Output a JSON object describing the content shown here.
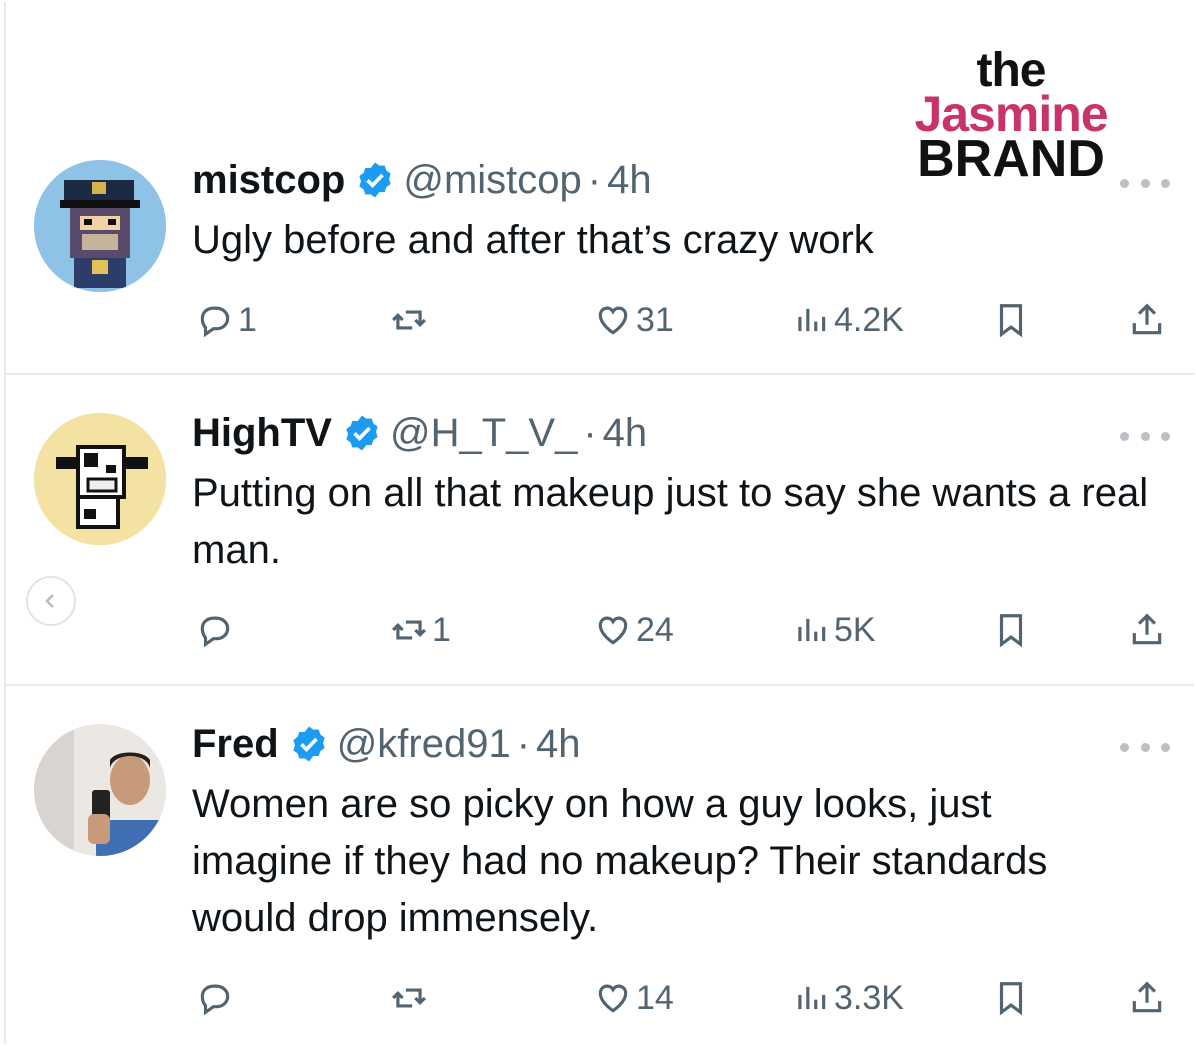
{
  "watermark": {
    "line1": "the",
    "line2": "Jasmine",
    "line3": "BRAND"
  },
  "tweets": [
    {
      "name": "mistcop",
      "handle": "@mistcop",
      "separator": "·",
      "time": "4h",
      "text": "Ugly before and after that’s crazy work",
      "avatar": "pixel-ape-captain-avatar",
      "replies": "1",
      "retweets": "",
      "likes": "31",
      "views": "4.2K"
    },
    {
      "name": "HighTV",
      "handle": "@H_T_V_",
      "separator": "·",
      "time": "4h",
      "text": "Putting on all that makeup just to say she wants a real man.",
      "avatar": "pixel-cow-avatar",
      "replies": "",
      "retweets": "1",
      "likes": "24",
      "views": "5K"
    },
    {
      "name": "Fred",
      "handle": "@kfred91",
      "separator": "·",
      "time": "4h",
      "text": "Women are so picky on how a guy looks, just imagine if they had no makeup? Their standards would drop immensely.",
      "avatar": "selfie-photo-avatar",
      "replies": "",
      "retweets": "",
      "likes": "14",
      "views": "3.3K"
    }
  ],
  "colors": {
    "verified": "#1d9bf0",
    "muted": "#536471",
    "brand_pink": "#c7336a",
    "divider": "#e7e9ea"
  }
}
